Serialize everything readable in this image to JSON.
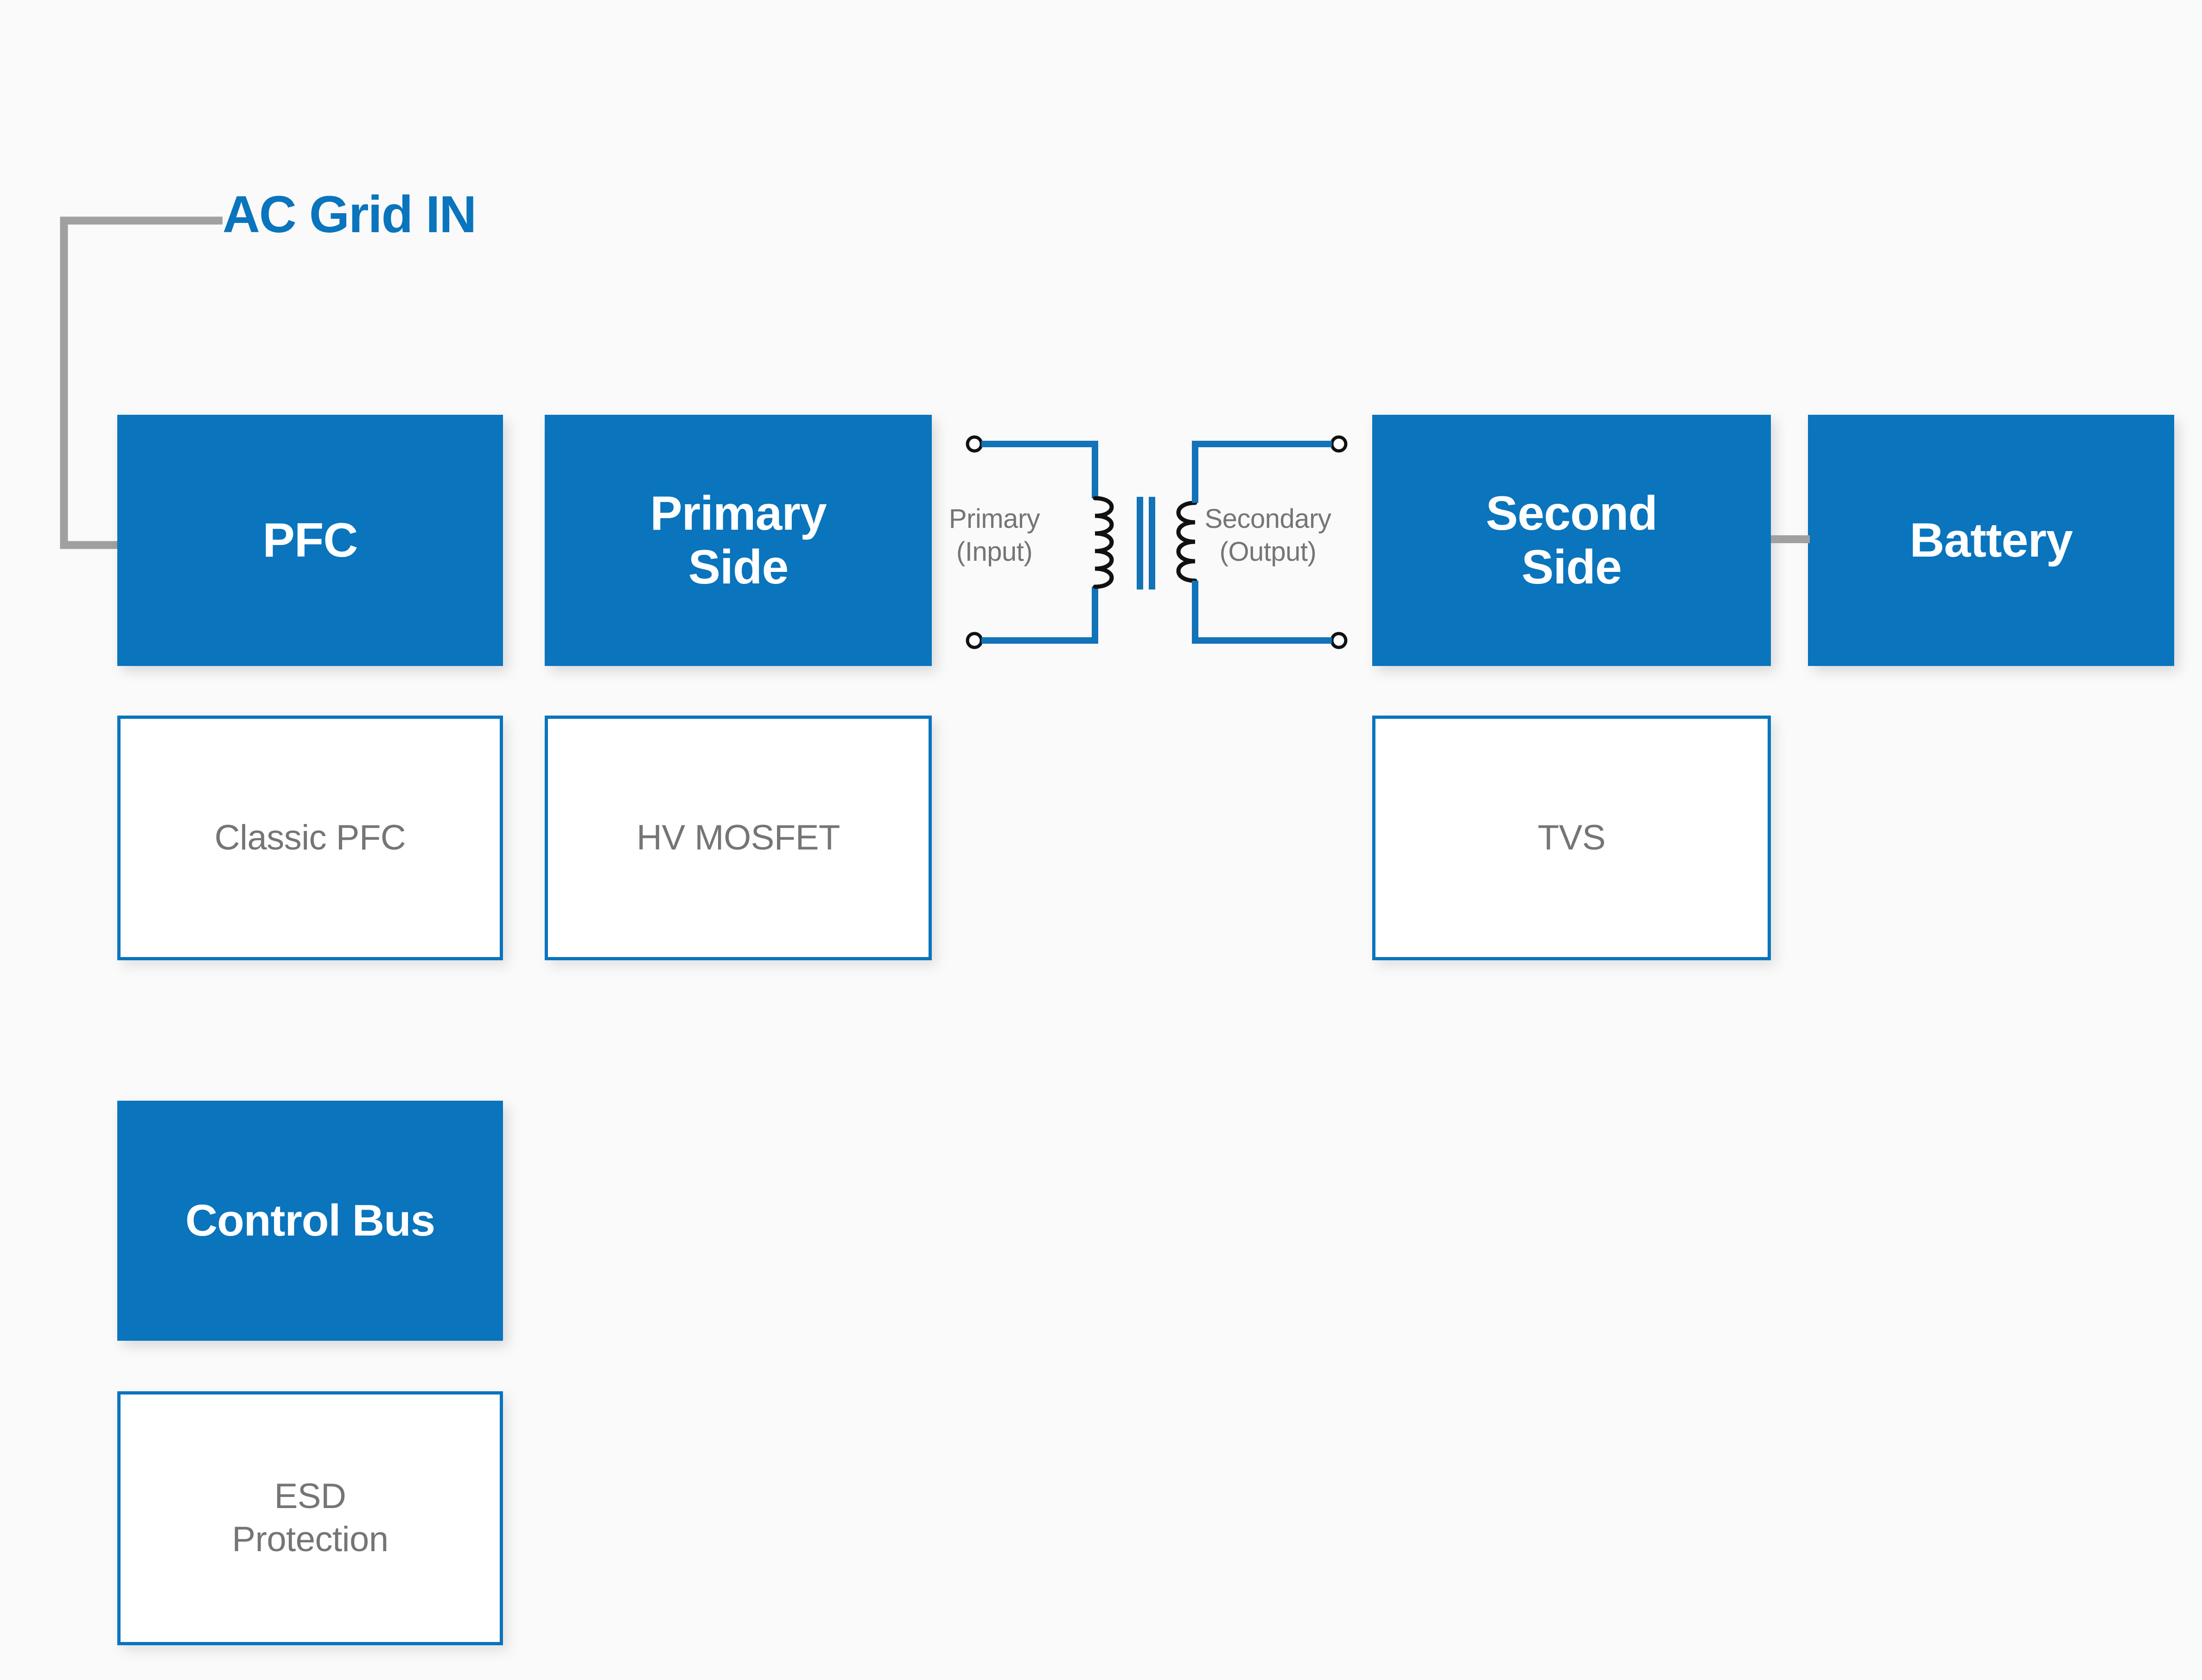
{
  "diagram": {
    "title": "AC Grid IN",
    "colors": {
      "accent_blue": "#0a74bd",
      "text_gray": "#757575",
      "connector_gray": "#a0a0a0",
      "background": "#fafafa",
      "box_text_white": "#ffffff"
    },
    "input_label": "AC Grid IN",
    "stages": [
      {
        "id": "pfc",
        "label": "PFC",
        "label_lines": [
          "PFC"
        ],
        "component": "Classic PFC",
        "component_lines": [
          "Classic PFC"
        ]
      },
      {
        "id": "primary-side",
        "label": "Primary Side",
        "label_lines": [
          "Primary",
          "Side"
        ],
        "component": "HV MOSFET",
        "component_lines": [
          "HV MOSFET"
        ]
      },
      {
        "id": "second-side",
        "label": "Second Side",
        "label_lines": [
          "Second",
          "Side"
        ],
        "component": "TVS",
        "component_lines": [
          "TVS"
        ]
      },
      {
        "id": "battery",
        "label": "Battery",
        "label_lines": [
          "Battery"
        ],
        "component": null,
        "component_lines": []
      }
    ],
    "control": {
      "label": "Control Bus",
      "label_lines": [
        "Control Bus"
      ],
      "component": "ESD Protection",
      "component_lines": [
        "ESD",
        "Protection"
      ]
    },
    "transformer": {
      "primary_label": "Primary (Input)",
      "primary_label_lines": [
        "Primary",
        "(Input)"
      ],
      "secondary_label": "Secondary (Output)",
      "secondary_label_lines": [
        "Secondary",
        "(Output)"
      ],
      "primary_turns": 5,
      "secondary_turns": 4,
      "terminals": 4,
      "core_bars": 2
    }
  }
}
